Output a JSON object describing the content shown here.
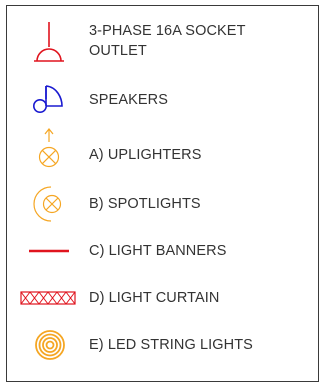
{
  "legend": {
    "items": [
      {
        "key": "socket",
        "label_line1": "3-PHASE 16A SOCKET",
        "label_line2": "OUTLET",
        "symbol": "socket-outlet-icon",
        "color": "#e0141e"
      },
      {
        "key": "speakers",
        "label": "SPEAKERS",
        "symbol": "speaker-icon",
        "color": "#1a1ad0"
      },
      {
        "key": "uplighters",
        "label": "A)   UPLIGHTERS",
        "symbol": "uplighter-icon",
        "color": "#f5a623"
      },
      {
        "key": "spotlights",
        "label": "B)   SPOTLIGHTS",
        "symbol": "spotlight-icon",
        "color": "#f5a623"
      },
      {
        "key": "banners",
        "label": "C)   LIGHT BANNERS",
        "symbol": "light-banner-icon",
        "color": "#e0141e"
      },
      {
        "key": "curtain",
        "label": "D)   LIGHT CURTAIN",
        "symbol": "light-curtain-icon",
        "color": "#e0141e"
      },
      {
        "key": "string",
        "label": "E)   LED STRING LIGHTS",
        "symbol": "led-string-icon",
        "color": "#f5a623"
      }
    ]
  }
}
